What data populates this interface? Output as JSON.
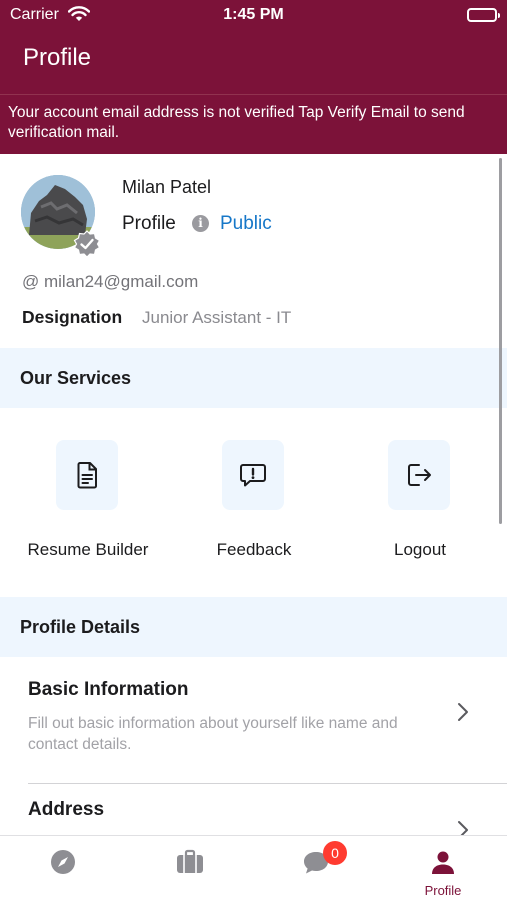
{
  "status_bar": {
    "carrier": "Carrier",
    "time": "1:45 PM"
  },
  "header": {
    "title": "Profile"
  },
  "banner": {
    "text": "Your account email address is not verified Tap Verify Email to send verification mail."
  },
  "profile": {
    "name": "Milan Patel",
    "visibility_label": "Profile",
    "visibility_value": "Public",
    "email": "@ milan24@gmail.com",
    "designation_label": "Designation",
    "designation_value": "Junior Assistant - IT"
  },
  "services": {
    "heading": "Our Services",
    "items": [
      {
        "label": "Resume Builder",
        "icon": "document-icon"
      },
      {
        "label": "Feedback",
        "icon": "feedback-icon"
      },
      {
        "label": "Logout",
        "icon": "logout-icon"
      }
    ]
  },
  "profile_details": {
    "heading": "Profile Details",
    "items": [
      {
        "title": "Basic Information",
        "subtitle": "Fill out basic information about yourself like name and contact details."
      },
      {
        "title": "Address",
        "subtitle": ""
      }
    ]
  },
  "tab_bar": {
    "items": [
      {
        "icon": "compass-icon",
        "label": ""
      },
      {
        "icon": "briefcase-icon",
        "label": ""
      },
      {
        "icon": "chat-icon",
        "label": "",
        "badge": "0"
      },
      {
        "icon": "person-icon",
        "label": "Profile",
        "active": true
      }
    ]
  },
  "colors": {
    "brand": "#7c1239",
    "link": "#1677c8",
    "section_bg": "#eef6fe",
    "badge": "#ff3b30"
  }
}
